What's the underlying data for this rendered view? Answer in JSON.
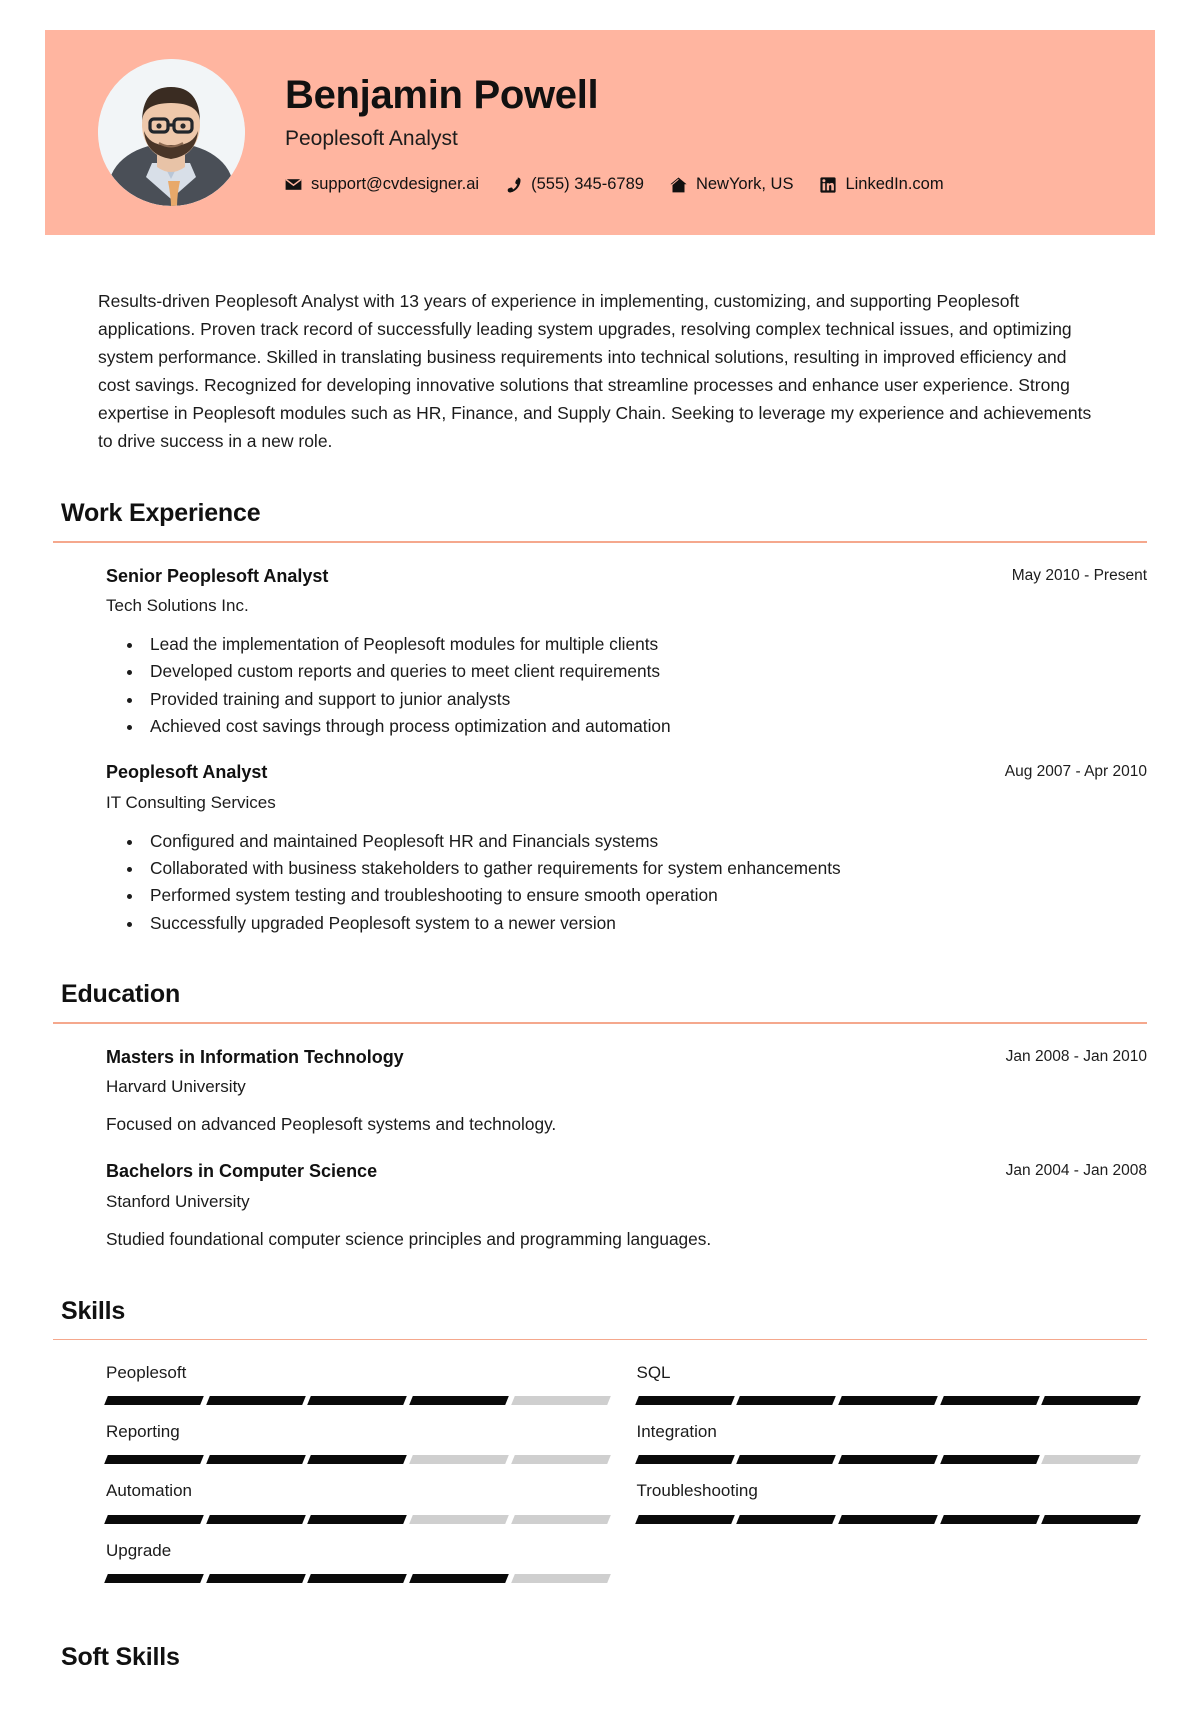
{
  "theme": {
    "banner_color": "#FFB5A0",
    "rule_color": "#F5A88D",
    "bar_filled_color": "#0A0A0A",
    "bar_empty_color": "#CFCFCF",
    "text_color": "#1A1A1A"
  },
  "header": {
    "name": "Benjamin Powell",
    "title": "Peoplesoft Analyst",
    "contacts": [
      {
        "icon": "envelope-icon",
        "label": "support@cvdesigner.ai"
      },
      {
        "icon": "phone-icon",
        "label": "(555) 345-6789"
      },
      {
        "icon": "home-icon",
        "label": "NewYork, US"
      },
      {
        "icon": "linkedin-icon",
        "label": "LinkedIn.com"
      }
    ]
  },
  "summary": "Results-driven Peoplesoft Analyst with 13 years of experience in implementing, customizing, and supporting Peoplesoft applications. Proven track record of successfully leading system upgrades, resolving complex technical issues, and optimizing system performance. Skilled in translating business requirements into technical solutions, resulting in improved efficiency and cost savings. Recognized for developing innovative solutions that streamline processes and enhance user experience. Strong expertise in Peoplesoft modules such as HR, Finance, and Supply Chain. Seeking to leverage my experience and achievements to drive success in a new role.",
  "sections": {
    "work_experience": {
      "title": "Work Experience",
      "entries": [
        {
          "title": "Senior Peoplesoft Analyst",
          "org": "Tech Solutions Inc.",
          "date": "May 2010 - Present",
          "bullets": [
            "Lead the implementation of Peoplesoft modules for multiple clients",
            "Developed custom reports and queries to meet client requirements",
            "Provided training and support to junior analysts",
            "Achieved cost savings through process optimization and automation"
          ]
        },
        {
          "title": "Peoplesoft Analyst",
          "org": "IT Consulting Services",
          "date": "Aug 2007 - Apr 2010",
          "bullets": [
            "Configured and maintained Peoplesoft HR and Financials systems",
            "Collaborated with business stakeholders to gather requirements for system enhancements",
            "Performed system testing and troubleshooting to ensure smooth operation",
            "Successfully upgraded Peoplesoft system to a newer version"
          ]
        }
      ]
    },
    "education": {
      "title": "Education",
      "entries": [
        {
          "title": "Masters in Information Technology",
          "org": "Harvard University",
          "date": "Jan 2008 - Jan 2010",
          "description": "Focused on advanced Peoplesoft systems and technology."
        },
        {
          "title": "Bachelors in Computer Science",
          "org": "Stanford University",
          "date": "Jan 2004 - Jan 2008",
          "description": "Studied foundational computer science principles and programming languages."
        }
      ]
    },
    "skills": {
      "title": "Skills",
      "max_level": 5,
      "items": [
        {
          "name": "Peoplesoft",
          "level": 4
        },
        {
          "name": "SQL",
          "level": 5
        },
        {
          "name": "Reporting",
          "level": 3
        },
        {
          "name": "Integration",
          "level": 4
        },
        {
          "name": "Automation",
          "level": 3
        },
        {
          "name": "Troubleshooting",
          "level": 5
        },
        {
          "name": "Upgrade",
          "level": 4
        }
      ]
    },
    "soft_skills": {
      "title": "Soft Skills"
    }
  }
}
